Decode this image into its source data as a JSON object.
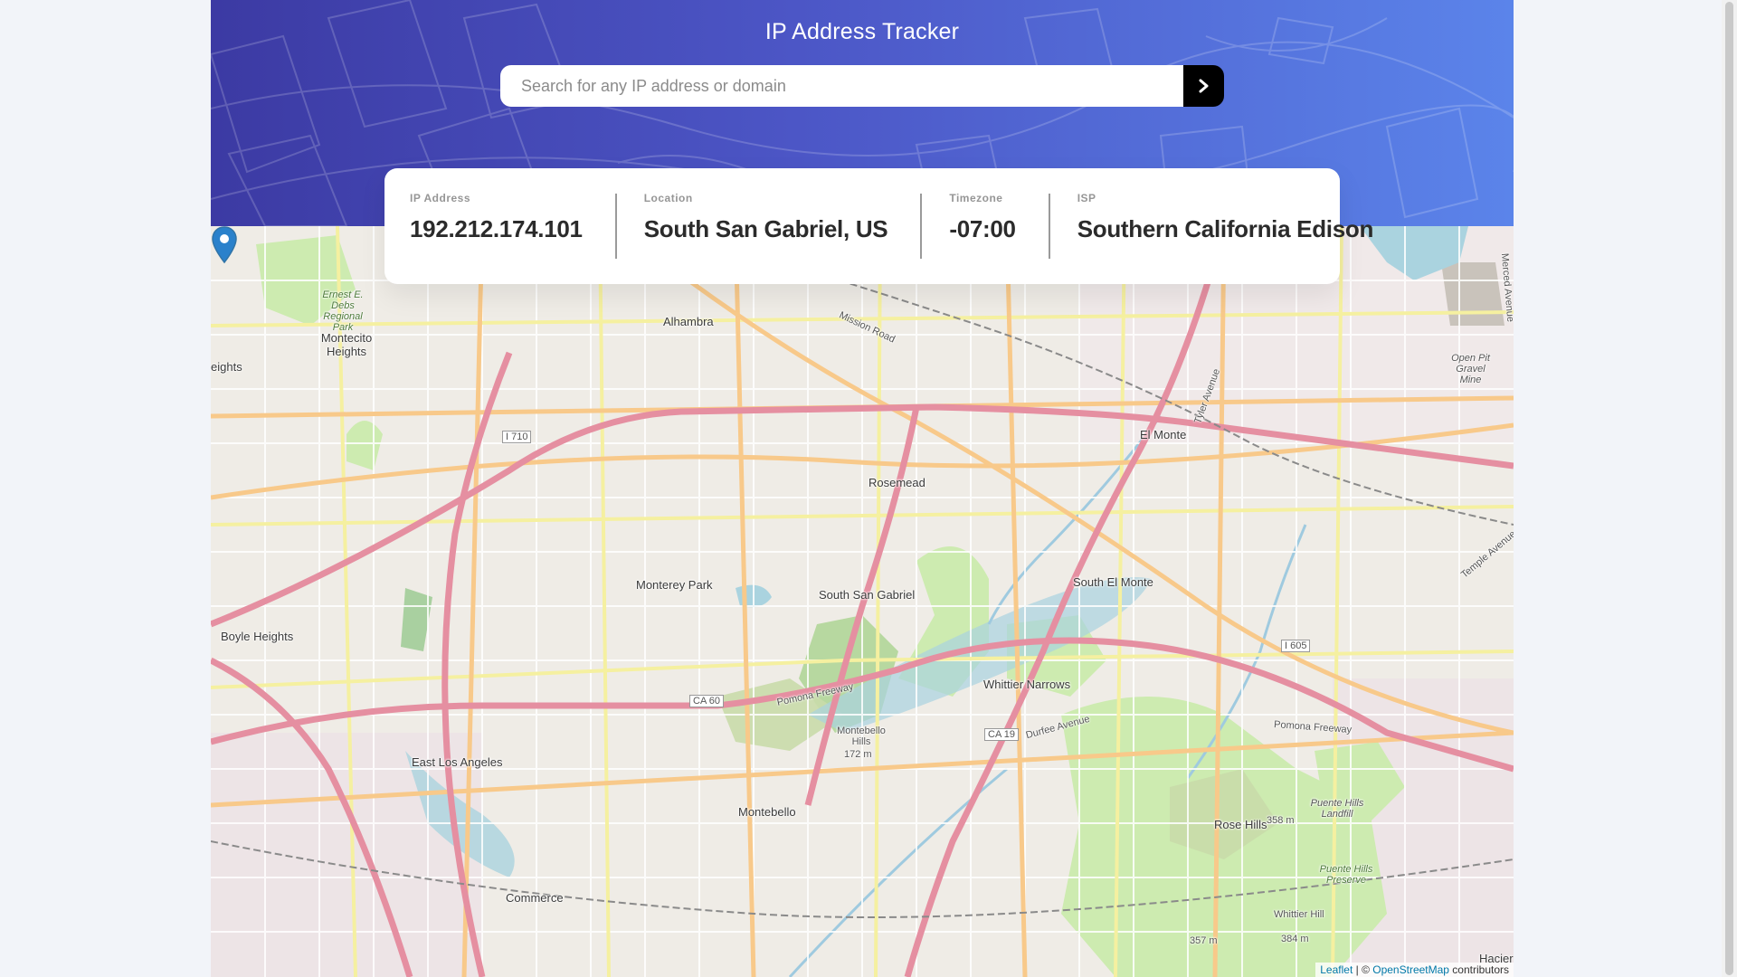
{
  "header": {
    "title": "IP Address Tracker",
    "search_placeholder": "Search for any IP address or domain",
    "search_value": ""
  },
  "info": {
    "ip_label": "IP Address",
    "ip_value": "192.212.174.101",
    "location_label": "Location",
    "location_value": "South San Gabriel, US",
    "timezone_label": "Timezone",
    "timezone_value": "-07:00",
    "isp_label": "ISP",
    "isp_value": "Southern California Edison"
  },
  "map": {
    "marker_label": "South San Gabriel",
    "places": [
      "San Gabriel",
      "Alhambra",
      "Rosemead",
      "El Monte",
      "Monterey Park",
      "South San Gabriel",
      "South El Monte",
      "Whittier Narrows",
      "Montebello",
      "East Los Angeles",
      "Commerce",
      "Boyle Heights",
      "Montecito Heights",
      "Rose Hills",
      "Ernest E. Debs Regional Park",
      "Montebello Hills",
      "172 m",
      "Open Pit Gravel Mine",
      "Puente Hills Landfill",
      "Puente Hills Preserve",
      "Whittier Hill",
      "384 m",
      "357 m",
      "358 m",
      "eights",
      "Hacier"
    ],
    "road_labels": [
      "I 710",
      "I 605",
      "CA 60",
      "CA 19",
      "Pomona Freeway",
      "Mission Road",
      "Durfee Avenue",
      "Tyler Avenue",
      "Temple Avenue",
      "Merced Avenue"
    ],
    "attribution_leaflet": "Leaflet",
    "attribution_sep": " | © ",
    "attribution_osm": "OpenStreetMap",
    "attribution_suffix": " contributors"
  },
  "colors": {
    "header_start": "#3c3aa3",
    "header_end": "#5b84ea",
    "search_button": "#000000",
    "marker": "#2a81cb",
    "motorway": "#e892a2",
    "primary_road": "#fcd6a4",
    "secondary_road": "#f7fabf",
    "park": "#c8facc",
    "water": "#aad3df"
  },
  "icons": {
    "search_button_icon": "chevron-right-icon",
    "marker_icon": "map-pin-icon"
  }
}
